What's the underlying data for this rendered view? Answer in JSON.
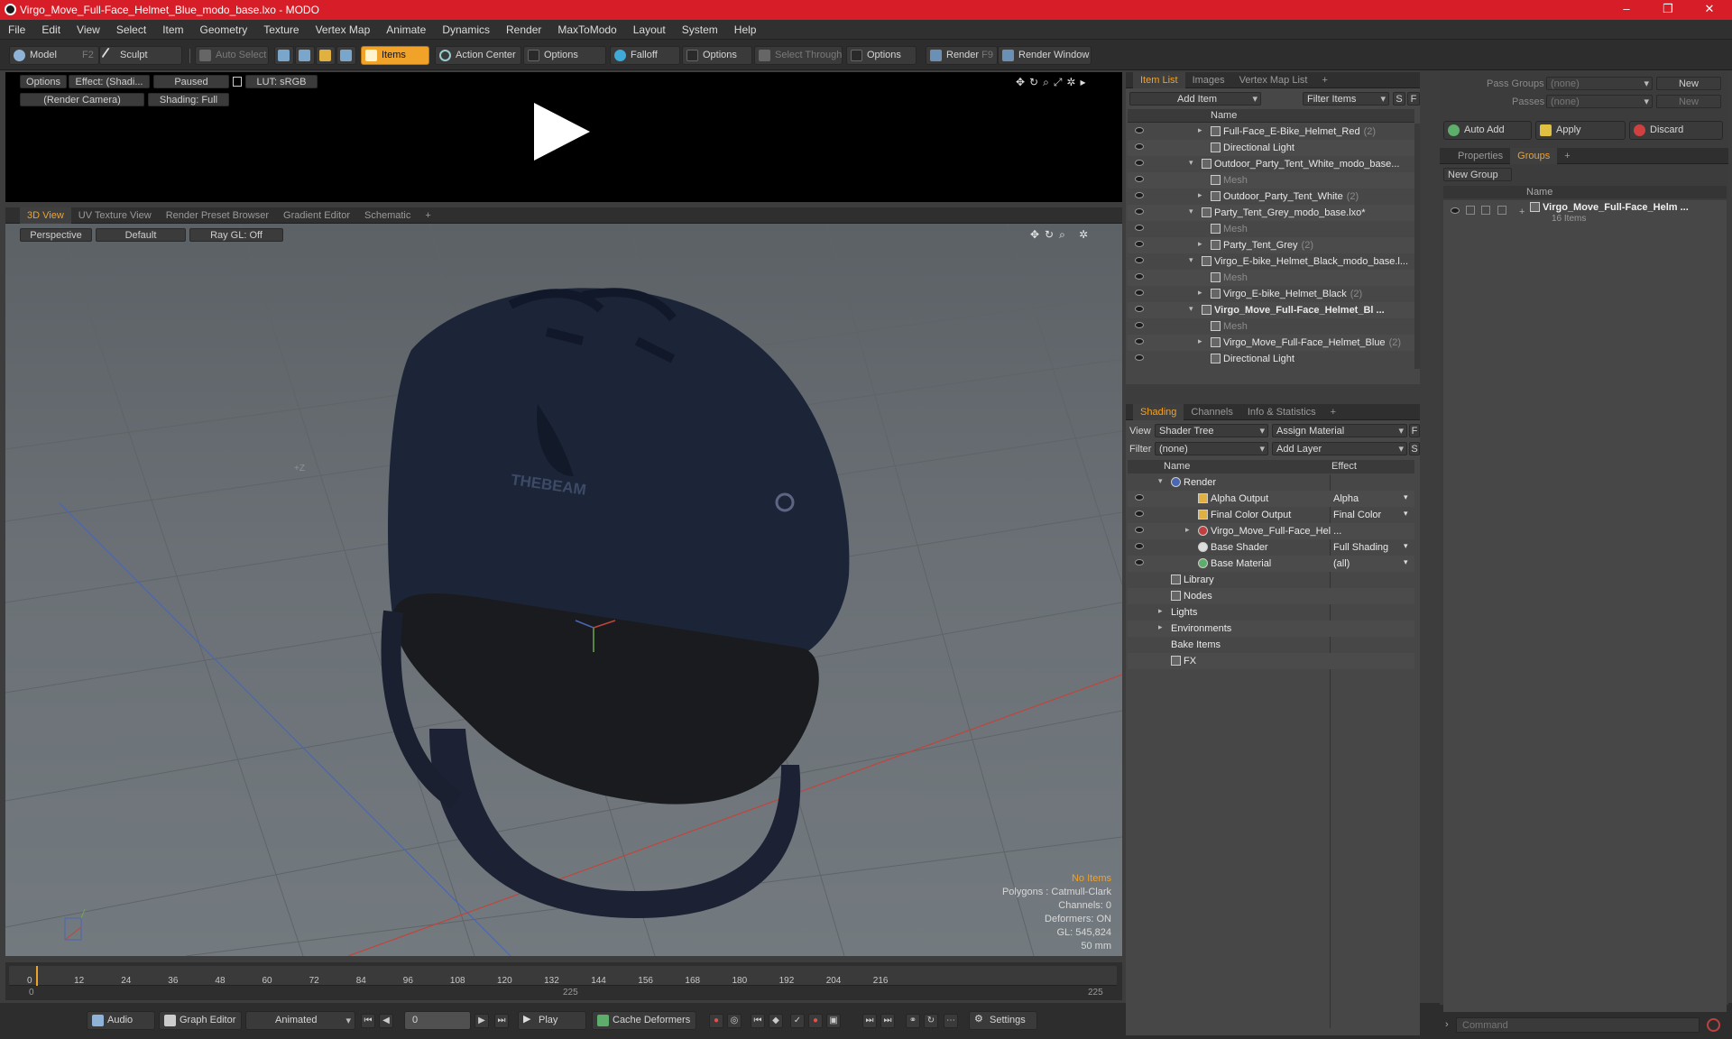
{
  "title": "Virgo_Move_Full-Face_Helmet_Blue_modo_base.lxo - MODO",
  "window_controls": {
    "minimize": "–",
    "restore": "❐",
    "close": "✕"
  },
  "menu": [
    "File",
    "Edit",
    "View",
    "Select",
    "Item",
    "Geometry",
    "Texture",
    "Vertex Map",
    "Animate",
    "Dynamics",
    "Render",
    "MaxToModo",
    "Layout",
    "System",
    "Help"
  ],
  "toolbar": {
    "model": "Model",
    "model_key": "F2",
    "sculpt": "Sculpt",
    "auto_select": "Auto Select",
    "items": "Items",
    "action_center": "Action Center",
    "options1": "Options",
    "falloff": "Falloff",
    "options2": "Options",
    "select_through": "Select Through",
    "options3": "Options",
    "render": "Render",
    "render_key": "F9",
    "render_window": "Render Window"
  },
  "preview": {
    "options": "Options",
    "effect": "Effect: (Shadi...",
    "status": "Paused",
    "lut": "LUT: sRGB",
    "camera": "(Render Camera)",
    "shading": "Shading: Full"
  },
  "view_tabs": [
    "3D View",
    "UV Texture View",
    "Render Preset Browser",
    "Gradient Editor",
    "Schematic"
  ],
  "viewport": {
    "perspective": "Perspective",
    "default": "Default",
    "raygl": "Ray GL: Off",
    "brand_text": "THEBEAM",
    "info": {
      "no_items": "No Items",
      "polygons": "Polygons : Catmull-Clark",
      "channels": "Channels: 0",
      "deformers": "Deformers: ON",
      "gl": "GL: 545,824",
      "unit": "50 mm"
    },
    "axis_label": "+Z",
    "colors": {
      "helmet": "#1c2538",
      "visor": "#1a1b1e",
      "accent": "#f1a229"
    }
  },
  "timeline": {
    "ticks": [
      "0",
      "12",
      "24",
      "36",
      "48",
      "60",
      "72",
      "84",
      "96",
      "108",
      "120",
      "132",
      "144",
      "156",
      "168",
      "180",
      "192",
      "204",
      "216"
    ],
    "start": "0",
    "mid": "225",
    "end": "225"
  },
  "bottombar": {
    "audio": "Audio",
    "graph_editor": "Graph Editor",
    "animated": "Animated",
    "frame": "0",
    "play": "Play",
    "cache": "Cache Deformers",
    "settings": "Settings"
  },
  "item_list": {
    "tabs": [
      "Item List",
      "Images",
      "Vertex Map List"
    ],
    "add_item": "Add Item",
    "filter": "Filter Items",
    "s": "S",
    "f": "F",
    "col_name": "Name",
    "rows": [
      {
        "label": "Full-Face_E-Bike_Helmet_Red",
        "count": "(2)"
      },
      {
        "label": "Directional Light",
        "count": ""
      },
      {
        "label": "Outdoor_Party_Tent_White_modo_base...",
        "count": ""
      },
      {
        "label": "Mesh",
        "count": ""
      },
      {
        "label": "Outdoor_Party_Tent_White",
        "count": "(2)"
      },
      {
        "label": "Party_Tent_Grey_modo_base.lxo*",
        "count": ""
      },
      {
        "label": "Mesh",
        "count": ""
      },
      {
        "label": "Party_Tent_Grey",
        "count": "(2)"
      },
      {
        "label": "Virgo_E-bike_Helmet_Black_modo_base.l...",
        "count": ""
      },
      {
        "label": "Mesh",
        "count": ""
      },
      {
        "label": "Virgo_E-bike_Helmet_Black",
        "count": "(2)"
      },
      {
        "label": "Virgo_Move_Full-Face_Helmet_Bl ...",
        "count": ""
      },
      {
        "label": "Mesh",
        "count": ""
      },
      {
        "label": "Virgo_Move_Full-Face_Helmet_Blue",
        "count": "(2)"
      },
      {
        "label": "Directional Light",
        "count": ""
      }
    ]
  },
  "shading": {
    "tabs": [
      "Shading",
      "Channels",
      "Info & Statistics"
    ],
    "view_label": "View",
    "view_value": "Shader Tree",
    "assign": "Assign Material",
    "f": "F",
    "filter_label": "Filter",
    "filter_value": "(none)",
    "add_layer": "Add Layer",
    "s": "S",
    "col_name": "Name",
    "col_effect": "Effect",
    "rows": [
      {
        "name": "Render",
        "effect": ""
      },
      {
        "name": "Alpha Output",
        "effect": "Alpha"
      },
      {
        "name": "Final Color Output",
        "effect": "Final Color"
      },
      {
        "name": "Virgo_Move_Full-Face_Hel ...",
        "effect": ""
      },
      {
        "name": "Base Shader",
        "effect": "Full Shading"
      },
      {
        "name": "Base Material",
        "effect": "(all)"
      },
      {
        "name": "Library",
        "effect": ""
      },
      {
        "name": "Nodes",
        "effect": ""
      },
      {
        "name": "Lights",
        "effect": ""
      },
      {
        "name": "Environments",
        "effect": ""
      },
      {
        "name": "Bake Items",
        "effect": ""
      },
      {
        "name": "FX",
        "effect": ""
      }
    ]
  },
  "groups": {
    "pass_groups": "Pass Groups",
    "pass_value": "(none)",
    "new": "New",
    "passes": "Passes",
    "passes_value": "(none)",
    "new2": "New",
    "auto_add": "Auto Add",
    "apply": "Apply",
    "discard": "Discard",
    "tabs": [
      "Properties",
      "Groups"
    ],
    "new_group": "New Group",
    "col_name": "Name",
    "item": "Virgo_Move_Full-Face_Helm ...",
    "item_count": "16 Items"
  },
  "command_placeholder": "Command"
}
